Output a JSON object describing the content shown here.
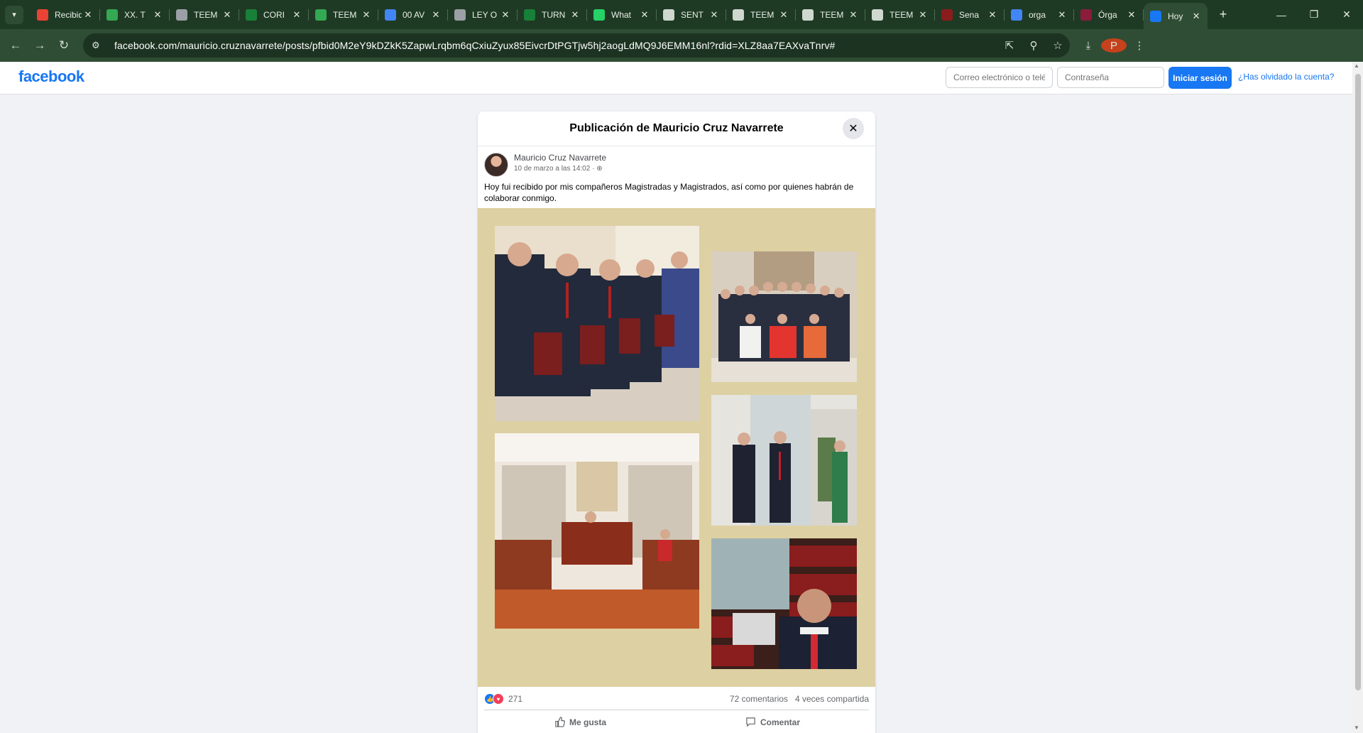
{
  "browser": {
    "tabs": [
      {
        "label": "Recibidos",
        "icon": "gmail-icon",
        "color": "#ea4335"
      },
      {
        "label": "XX. T",
        "icon": "drive-icon",
        "color": "#34a853"
      },
      {
        "label": "TEEM",
        "icon": "globe-icon",
        "color": "#9aa0a6"
      },
      {
        "label": "CORI",
        "icon": "sheets-icon",
        "color": "#188038"
      },
      {
        "label": "TEEM",
        "icon": "drive-icon",
        "color": "#34a853"
      },
      {
        "label": "00 AV",
        "icon": "docs-icon",
        "color": "#4285f4"
      },
      {
        "label": "LEY O",
        "icon": "globe-icon",
        "color": "#9aa0a6"
      },
      {
        "label": "TURN",
        "icon": "sheets-icon",
        "color": "#188038"
      },
      {
        "label": "What",
        "icon": "whatsapp-icon",
        "color": "#25d366"
      },
      {
        "label": "SENT",
        "icon": "flag-icon",
        "color": "#cfd8cf"
      },
      {
        "label": "TEEM",
        "icon": "flag-icon",
        "color": "#cfd8cf"
      },
      {
        "label": "TEEM",
        "icon": "flag-icon",
        "color": "#cfd8cf"
      },
      {
        "label": "TEEM",
        "icon": "flag-icon",
        "color": "#cfd8cf"
      },
      {
        "label": "Sena",
        "icon": "senado-icon",
        "color": "#8b1c1c"
      },
      {
        "label": "orga",
        "icon": "google-icon",
        "color": "#4285f4"
      },
      {
        "label": "Órga",
        "icon": "scjn-icon",
        "color": "#8b1c3b"
      },
      {
        "label": "Hoy",
        "icon": "facebook-icon",
        "color": "#1877f2",
        "active": true
      }
    ],
    "new_tab": "+",
    "url": "facebook.com/mauricio.cruznavarrete/posts/pfbid0M2eY9kDZkK5ZapwLrqbm6qCxiuZyux85EivcrDtPGTjw5hj2aogLdMQ9J6EMM16nl?rdid=XLZ8aa7EAXvaTnrv#",
    "profile_initial": "P"
  },
  "fb_header": {
    "logo": "facebook",
    "email_placeholder": "Correo electrónico o teléfono",
    "password_placeholder": "Contraseña",
    "login_label": "Iniciar sesión",
    "forgot_label": "¿Has olvidado la cuenta?"
  },
  "post": {
    "dialog_title": "Publicación de Mauricio Cruz Navarrete",
    "author": "Mauricio Cruz Navarrete",
    "date": "10 de marzo a las 14:02 ·",
    "text": "Hoy fui recibido por mis compañeros Magistradas y Magistrados, así como por quienes habrán de colaborar conmigo.",
    "reaction_count": "271",
    "comments": "72 comentarios",
    "shares": "4 veces compartida",
    "like_label": "Me gusta",
    "comment_label": "Comentar",
    "gallery_bg": "#ddd0a2"
  },
  "colors": {
    "fb_blue": "#1877f2",
    "chrome_frame": "#1f3a24"
  }
}
